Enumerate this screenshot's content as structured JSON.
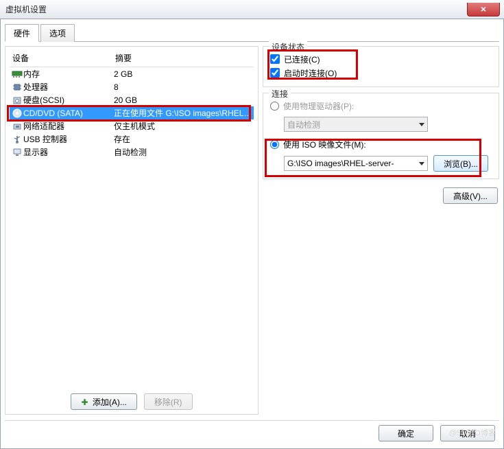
{
  "window": {
    "title": "虚拟机设置",
    "close_icon": "×"
  },
  "tabs": {
    "hardware": "硬件",
    "options": "选项"
  },
  "columns": {
    "device": "设备",
    "summary": "摘要"
  },
  "devices": [
    {
      "icon": "memory",
      "name": "内存",
      "summary": "2 GB"
    },
    {
      "icon": "cpu",
      "name": "处理器",
      "summary": "8"
    },
    {
      "icon": "hdd",
      "name": "硬盘(SCSI)",
      "summary": "20 GB"
    },
    {
      "icon": "cd",
      "name": "CD/DVD (SATA)",
      "summary": "正在使用文件 G:\\ISO images\\RHEL-..."
    },
    {
      "icon": "nic",
      "name": "网络适配器",
      "summary": "仅主机模式"
    },
    {
      "icon": "usb",
      "name": "USB 控制器",
      "summary": "存在"
    },
    {
      "icon": "display",
      "name": "显示器",
      "summary": "自动检测"
    }
  ],
  "selected_index": 3,
  "left_buttons": {
    "add": "添加(A)...",
    "remove": "移除(R)"
  },
  "status_group": {
    "title": "设备状态",
    "connected": {
      "label": "已连接(C)",
      "checked": true
    },
    "connect_at_power": {
      "label": "启动时连接(O)",
      "checked": true
    }
  },
  "connection_group": {
    "title": "连接",
    "physical": {
      "label": "使用物理驱动器(P):",
      "checked": false,
      "combo": "自动检测"
    },
    "iso": {
      "label": "使用 ISO 映像文件(M):",
      "checked": true,
      "path": "G:\\ISO images\\RHEL-server-",
      "browse": "浏览(B)..."
    }
  },
  "advanced": "高级(V)...",
  "footer": {
    "ok": "确定",
    "cancel": "取消"
  },
  "watermark": "@51CTO博客"
}
